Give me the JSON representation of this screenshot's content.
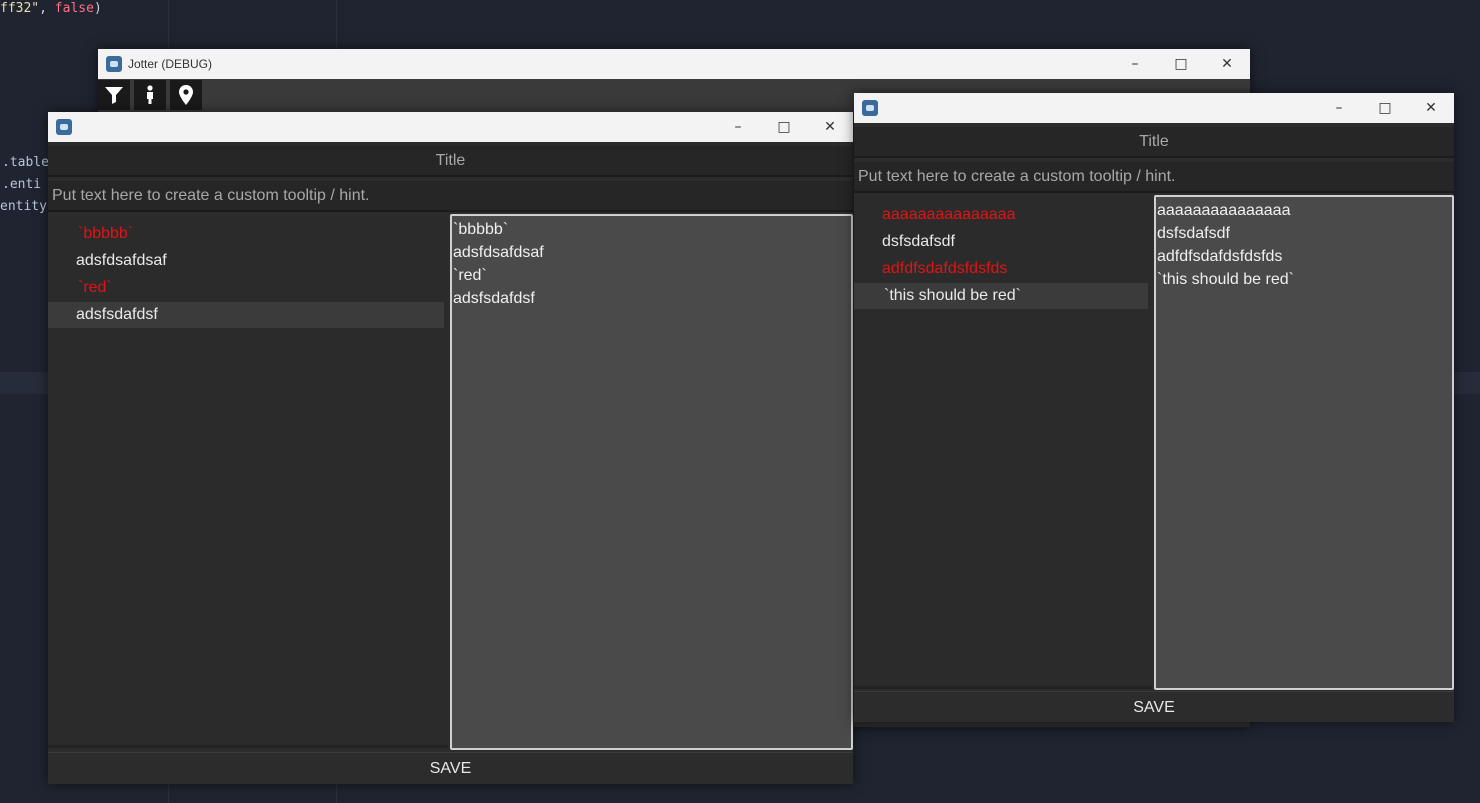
{
  "editor": {
    "line1_str": "ff32\"",
    "line1_comma": ", ",
    "line1_kw": "false",
    "line1_close": ")",
    "frag1": ".table",
    "frag2": ".enti",
    "frag3": "entity"
  },
  "main_window": {
    "title": "Jotter (DEBUG)",
    "toolbar": [
      {
        "icon": "filter-icon"
      },
      {
        "icon": "person-icon"
      },
      {
        "icon": "location-pin-icon"
      }
    ]
  },
  "left_dialog": {
    "title_value": "Title",
    "hint_placeholder": "Put text here to create a custom tooltip / hint.",
    "list": [
      {
        "text": "`bbbbb`",
        "red": true
      },
      {
        "text": "adsfdsafdsaf",
        "red": false
      },
      {
        "text": "`red`",
        "red": true
      },
      {
        "text": "adsfsdafdsf",
        "red": false,
        "selected": true
      }
    ],
    "text_lines": [
      "`bbbbb`",
      "adsfdsafdsaf",
      "`red`",
      "adsfsdafdsf"
    ],
    "save_label": "SAVE"
  },
  "right_dialog": {
    "title_value": "Title",
    "hint_placeholder": "Put text here to create a custom tooltip / hint.",
    "list": [
      {
        "text": "aaaaaaaaaaaaaaa",
        "red": true
      },
      {
        "text": "dsfsdafsdf",
        "red": false
      },
      {
        "text": "adfdfsdafdsfdsfds",
        "red": true
      },
      {
        "text": "`this should be red`",
        "red": false,
        "selected": true
      }
    ],
    "text_lines": [
      "aaaaaaaaaaaaaaa",
      "dsfsdafsdf",
      "adfdfsdafdsfdsfds",
      "`this should be red`"
    ],
    "save_label": "SAVE"
  },
  "colors": {
    "highlight_red": "#e01414",
    "editor_bg": "#1f2430",
    "panel_bg": "#2c2c2c",
    "text_area_bg": "#4a4a4a"
  }
}
